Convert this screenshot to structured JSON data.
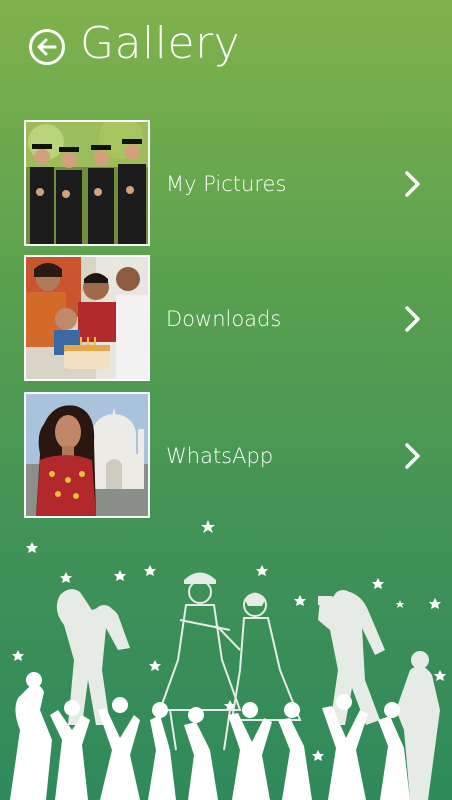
{
  "header": {
    "title": "Gallery",
    "back_icon": "arrow-left-circle-icon"
  },
  "items": [
    {
      "label": "My Pictures",
      "thumb": "graduates-photo"
    },
    {
      "label": "Downloads",
      "thumb": "family-birthday-photo"
    },
    {
      "label": "WhatsApp",
      "thumb": "woman-taj-mahal-photo"
    }
  ],
  "colors": {
    "bg_top": "#80b24b",
    "bg_bottom": "#2f8a5b",
    "silhouette": "#e8ece8"
  }
}
